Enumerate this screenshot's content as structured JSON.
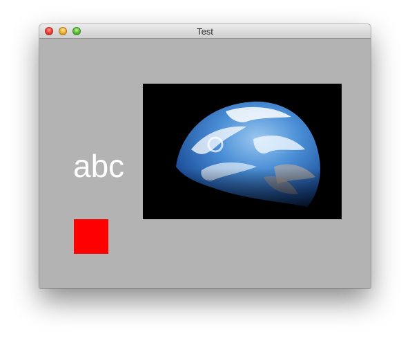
{
  "window": {
    "title": "Test"
  },
  "content": {
    "label_text": "abc",
    "square_color": "#ff0000",
    "image_subject": "earth-image"
  }
}
